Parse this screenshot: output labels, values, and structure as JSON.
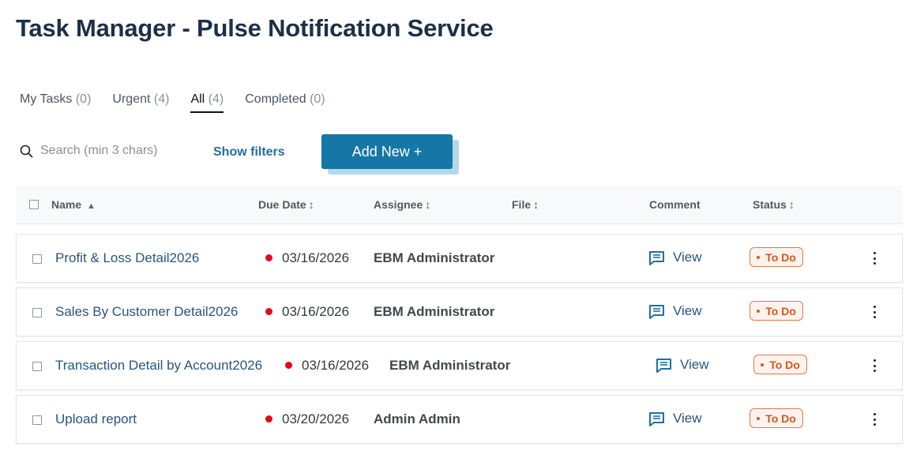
{
  "page_title": "Task Manager - Pulse Notification Service",
  "tabs": [
    {
      "label": "My Tasks",
      "count": "(0)"
    },
    {
      "label": "Urgent",
      "count": "(4)"
    },
    {
      "label": "All",
      "count": "(4)",
      "active": true
    },
    {
      "label": "Completed",
      "count": "(0)"
    }
  ],
  "toolbar": {
    "search_placeholder": "Search (min 3 chars)",
    "show_filters_label": "Show filters",
    "add_new_label": "Add New +"
  },
  "table": {
    "columns": {
      "name": "Name",
      "due_date": "Due Date",
      "assignee": "Assignee",
      "file": "File",
      "comment": "Comment",
      "status": "Status"
    },
    "sort_asc_glyph": "▲",
    "sortable_glyph": "↕",
    "rows": [
      {
        "name": "Profit & Loss Detail2026",
        "due_date": "03/16/2026",
        "assignee": "EBM Administrator",
        "comment": "View",
        "status": "To Do"
      },
      {
        "name": "Sales By Customer Detail2026",
        "due_date": "03/16/2026",
        "assignee": "EBM Administrator",
        "comment": "View",
        "status": "To Do"
      },
      {
        "name": "Transaction Detail by Account2026",
        "due_date": "03/16/2026",
        "assignee": "EBM Administrator",
        "comment": "View",
        "status": "To Do"
      },
      {
        "name": "Upload report",
        "due_date": "03/20/2026",
        "assignee": "Admin Admin",
        "comment": "View",
        "status": "To Do"
      }
    ]
  },
  "colors": {
    "accent": "#1577a6",
    "overdue_dot": "#e00b16",
    "status_todo": "#d9551b"
  },
  "icons": {
    "search": "search-icon",
    "comment": "comment-icon",
    "menu": "more-vertical-icon"
  }
}
